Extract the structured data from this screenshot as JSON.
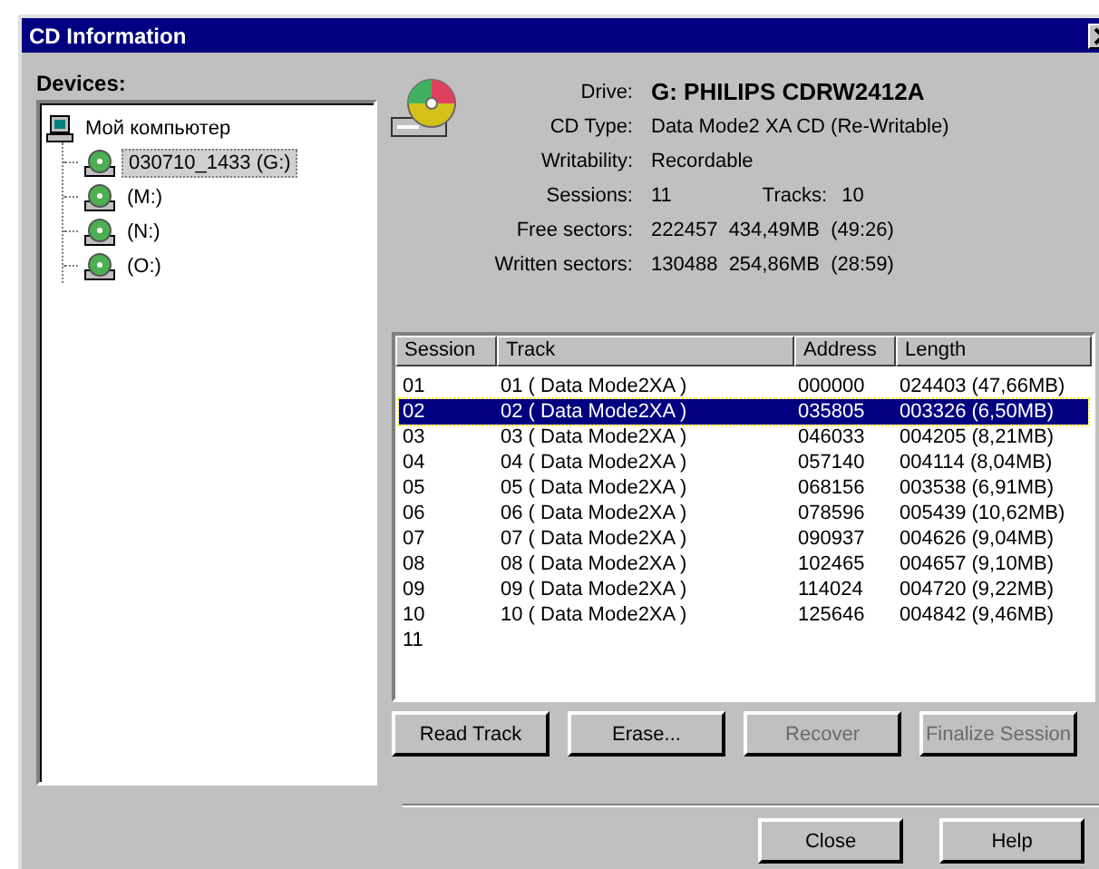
{
  "window": {
    "title": "CD Information"
  },
  "devices": {
    "label": "Devices:",
    "tree": [
      {
        "label": "Мой компьютер",
        "kind": "computer",
        "selected": false,
        "children": [
          {
            "label": "030710_1433 (G:)",
            "kind": "drive",
            "selected": true
          },
          {
            "label": "(M:)",
            "kind": "drive",
            "selected": false
          },
          {
            "label": "(N:)",
            "kind": "drive",
            "selected": false
          },
          {
            "label": "(O:)",
            "kind": "drive",
            "selected": false
          }
        ]
      }
    ]
  },
  "info": [
    {
      "label": "Drive:",
      "value": "G: PHILIPS CDRW2412A",
      "kind": "bold"
    },
    {
      "label": "CD Type:",
      "value": "Data Mode2 XA CD (Re-Writable)",
      "kind": "plain"
    },
    {
      "label": "Writability:",
      "value": "Recordable",
      "kind": "plain"
    },
    {
      "label": "Sessions:",
      "value": "11",
      "kind": "pair",
      "extra_label": "Tracks:",
      "extra_value": "10"
    },
    {
      "label": "Free sectors:",
      "value": "222457  434,49MB  (49:26)",
      "kind": "plain"
    },
    {
      "label": "Written sectors:",
      "value": "130488  254,86MB  (28:59)",
      "kind": "plain"
    }
  ],
  "table": {
    "columns": [
      "Session",
      "Track",
      "Address",
      "Length"
    ],
    "rows": [
      {
        "cells": [
          "01",
          "01 ( Data Mode2XA )",
          "000000",
          "024403 (47,66MB)"
        ],
        "selected": false
      },
      {
        "cells": [
          "02",
          "02 ( Data Mode2XA )",
          "035805",
          "003326 (6,50MB)"
        ],
        "selected": true
      },
      {
        "cells": [
          "03",
          "03 ( Data Mode2XA )",
          "046033",
          "004205 (8,21MB)"
        ],
        "selected": false
      },
      {
        "cells": [
          "04",
          "04 ( Data Mode2XA )",
          "057140",
          "004114 (8,04MB)"
        ],
        "selected": false
      },
      {
        "cells": [
          "05",
          "05 ( Data Mode2XA )",
          "068156",
          "003538 (6,91MB)"
        ],
        "selected": false
      },
      {
        "cells": [
          "06",
          "06 ( Data Mode2XA )",
          "078596",
          "005439 (10,62MB)"
        ],
        "selected": false
      },
      {
        "cells": [
          "07",
          "07 ( Data Mode2XA )",
          "090937",
          "004626 (9,04MB)"
        ],
        "selected": false
      },
      {
        "cells": [
          "08",
          "08 ( Data Mode2XA )",
          "102465",
          "004657 (9,10MB)"
        ],
        "selected": false
      },
      {
        "cells": [
          "09",
          "09 ( Data Mode2XA )",
          "114024",
          "004720 (9,22MB)"
        ],
        "selected": false
      },
      {
        "cells": [
          "10",
          "10 ( Data Mode2XA )",
          "125646",
          "004842 (9,46MB)"
        ],
        "selected": false
      },
      {
        "cells": [
          "11"
        ],
        "selected": false
      }
    ]
  },
  "actions": [
    {
      "label": "Read Track",
      "disabled": false
    },
    {
      "label": "Erase...",
      "disabled": false
    },
    {
      "label": "Recover",
      "disabled": true
    },
    {
      "label": "Finalize Session",
      "disabled": true
    }
  ],
  "dialog_buttons": [
    {
      "label": "Close",
      "disabled": false
    },
    {
      "label": "Help",
      "disabled": false
    }
  ]
}
